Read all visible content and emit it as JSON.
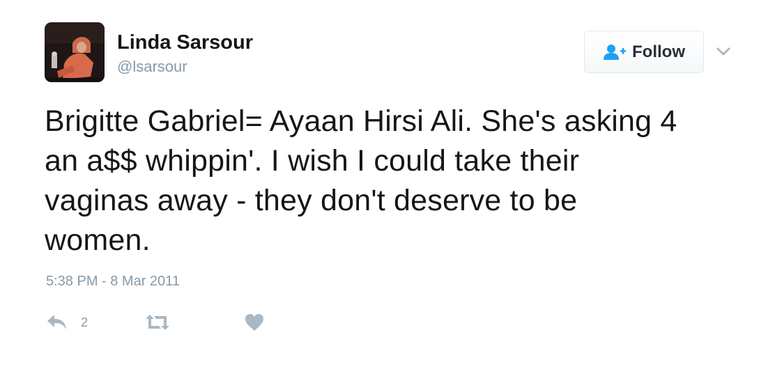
{
  "user": {
    "display_name": "Linda Sarsour",
    "handle": "@lsarsour"
  },
  "follow_button": {
    "label": "Follow",
    "icon": "follow-user-icon"
  },
  "tweet": {
    "lines": [
      "Brigitte Gabriel= Ayaan Hirsi Ali. She's asking 4",
      "an a$$ whippin'. I wish I could take their",
      "vaginas away - they don't deserve to be",
      "women."
    ],
    "timestamp": "5:38 PM - 8 Mar 2011"
  },
  "actions": {
    "reply": {
      "icon": "reply-icon",
      "count": "2"
    },
    "retweet": {
      "icon": "retweet-icon"
    },
    "like": {
      "icon": "heart-icon"
    }
  },
  "colors": {
    "text": "#14171a",
    "secondary": "#8899a6",
    "icon_blue": "#1da1f2",
    "border": "#e1e8ed"
  }
}
